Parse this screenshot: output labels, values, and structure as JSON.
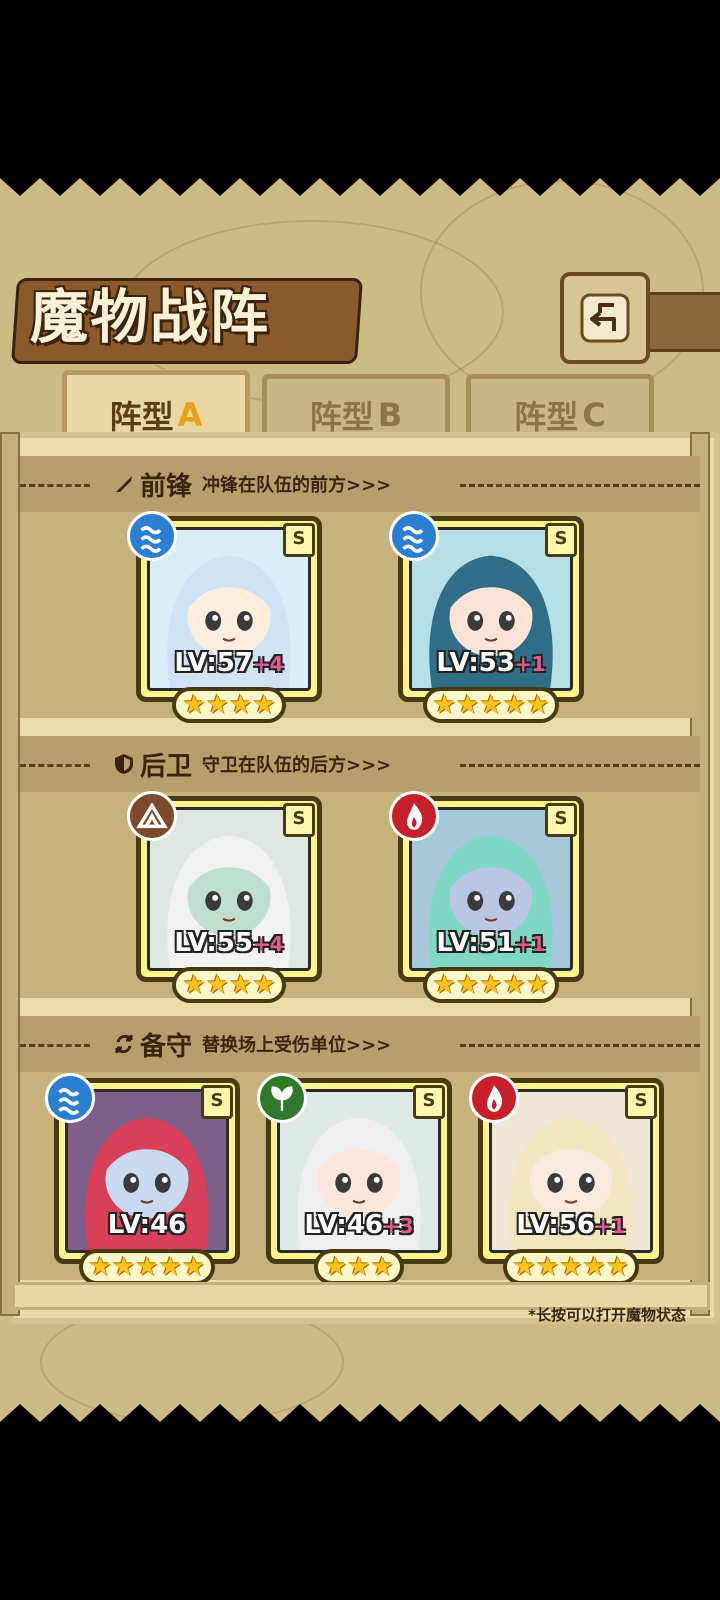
{
  "title": "魔物战阵",
  "back_icon": "back-arrow-icon",
  "tabs": [
    {
      "label": "阵型",
      "letter": "A",
      "active": true
    },
    {
      "label": "阵型",
      "letter": "B",
      "active": false
    },
    {
      "label": "阵型",
      "letter": "C",
      "active": false
    }
  ],
  "sections": {
    "front": {
      "label": "前锋",
      "sub": "冲锋在队伍的前方>>>",
      "icon": "sword-icon"
    },
    "rear": {
      "label": "后卫",
      "sub": "守卫在队伍的后方>>>",
      "icon": "shield-icon"
    },
    "reserve": {
      "label": "备守",
      "sub": "替换场上受伤单位>>>",
      "icon": "swap-icon"
    }
  },
  "front_cards": [
    {
      "element": "water",
      "rank": "S",
      "lv": "LV:57",
      "plus": "+4",
      "stars": 4,
      "hair": "#cfe3f5",
      "skin": "#fdeedd",
      "bg": "#d9eef7"
    },
    {
      "element": "water",
      "rank": "S",
      "lv": "LV:53",
      "plus": "+1",
      "stars": 5,
      "hair": "#2f6e86",
      "skin": "#fde4d8",
      "bg": "#b6dfe8"
    }
  ],
  "rear_cards": [
    {
      "element": "earth",
      "rank": "S",
      "lv": "LV:55",
      "plus": "+4",
      "stars": 4,
      "hair": "#f1f3f0",
      "skin": "#bfe0cf",
      "bg": "#dfe7e1"
    },
    {
      "element": "fire",
      "rank": "S",
      "lv": "LV:51",
      "plus": "+1",
      "stars": 5,
      "hair": "#7fd7c4",
      "skin": "#b9c7e3",
      "bg": "#a7c8d8"
    }
  ],
  "reserve_cards": [
    {
      "element": "water",
      "rank": "S",
      "lv": "LV:46",
      "plus": "",
      "stars": 5,
      "hair": "#d8405a",
      "skin": "#c9d9ef",
      "bg": "#7d5f8a"
    },
    {
      "element": "wood",
      "rank": "S",
      "lv": "LV:46",
      "plus": "+3",
      "stars": 3,
      "hair": "#f0f0f0",
      "skin": "#fde7dd",
      "bg": "#dfeae6"
    },
    {
      "element": "fire",
      "rank": "S",
      "lv": "LV:56",
      "plus": "+1",
      "stars": 5,
      "hair": "#f4e6c0",
      "skin": "#fdeade",
      "bg": "#efe8d6"
    }
  ],
  "element_colors": {
    "water": "#2a7fd0",
    "earth": "#7a4a2a",
    "fire": "#c8202a",
    "wood": "#2f7a2a"
  },
  "footnote": "*长按可以打开魔物状态"
}
